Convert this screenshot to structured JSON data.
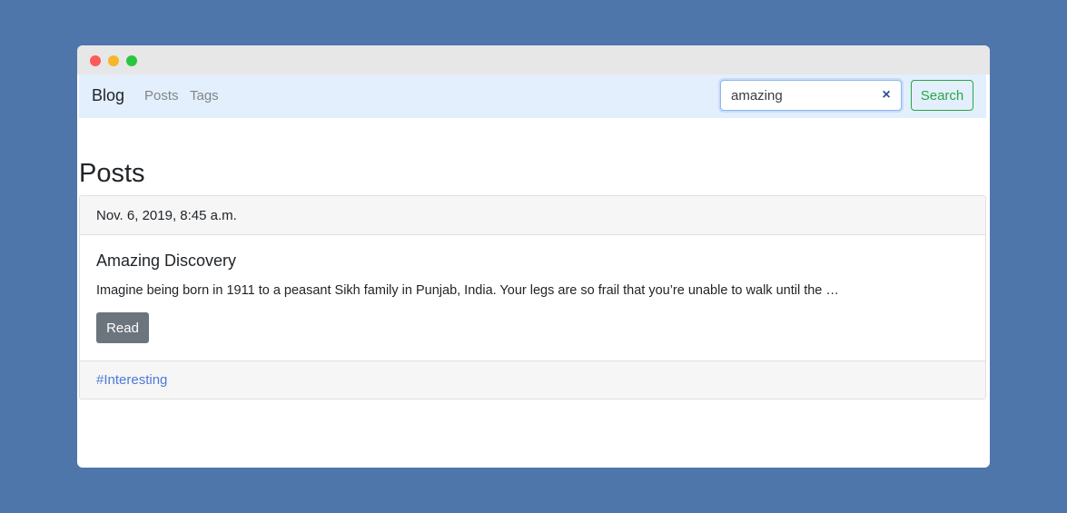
{
  "navbar": {
    "brand": "Blog",
    "links": [
      "Posts",
      "Tags"
    ]
  },
  "search": {
    "value": "amazing",
    "clear_icon": "×",
    "button_label": "Search"
  },
  "page": {
    "title": "Posts"
  },
  "post": {
    "date": "Nov. 6, 2019, 8:45 a.m.",
    "title": "Amazing Discovery",
    "excerpt": "Imagine being born in 1911 to a peasant Sikh family in Punjab, India. Your legs are so frail that you’re unable to walk until the …",
    "read_label": "Read",
    "tag": "#Interesting"
  },
  "colors": {
    "background": "#4f76aa",
    "navbar": "#e3effc",
    "success": "#28a745",
    "secondary": "#6c757d",
    "link": "#4d79d6"
  }
}
